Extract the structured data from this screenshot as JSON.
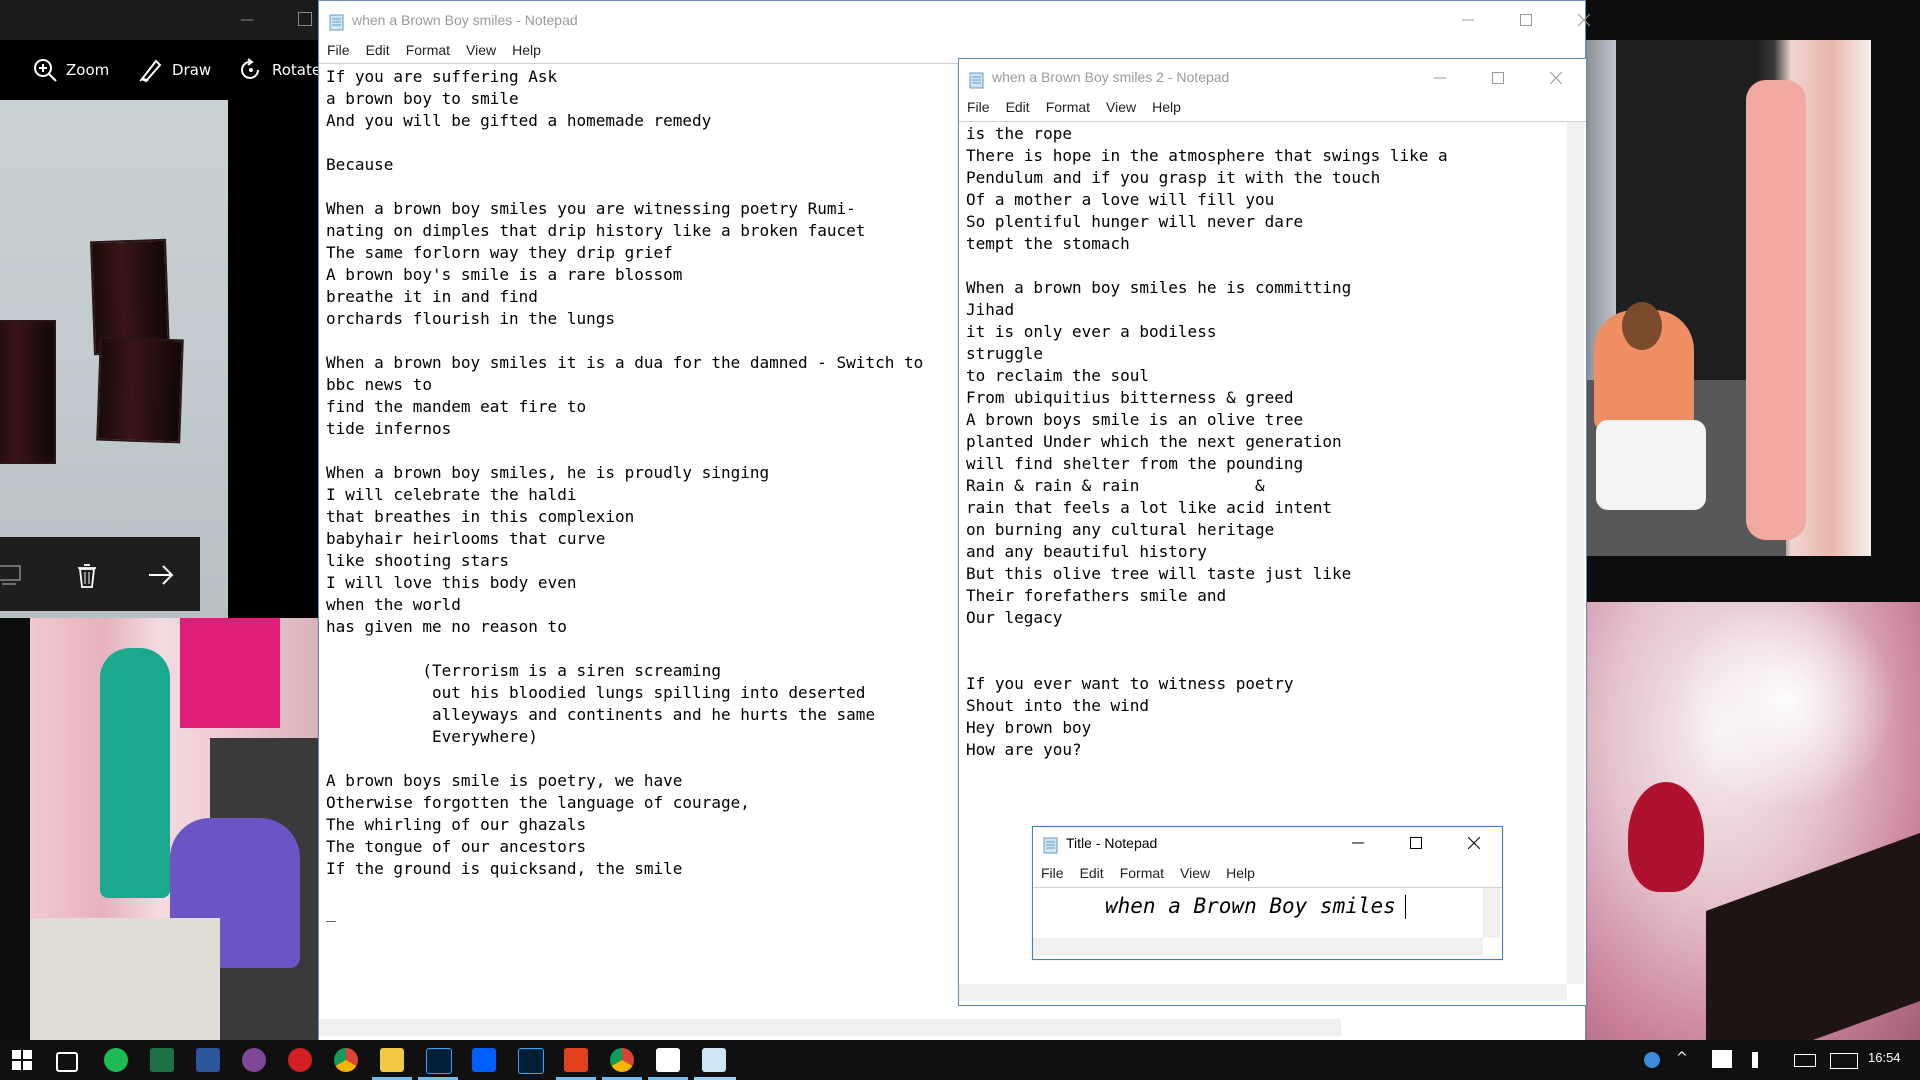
{
  "photos_app": {
    "toolbar": {
      "zoom": "Zoom",
      "draw": "Draw",
      "rotate": "Rotate"
    }
  },
  "notepad1": {
    "title": "when a Brown Boy smiles - Notepad",
    "menu": [
      "File",
      "Edit",
      "Format",
      "View",
      "Help"
    ],
    "text": "If you are suffering Ask\na brown boy to smile\nAnd you will be gifted a homemade remedy\n\nBecause\n\nWhen a brown boy smiles you are witnessing poetry Rumi-\nnating on dimples that drip history like a broken faucet\nThe same forlorn way they drip grief\nA brown boy's smile is a rare blossom\nbreathe it in and find\norchards flourish in the lungs\n\nWhen a brown boy smiles it is a dua for the damned - Switch to\nbbc news to\nfind the mandem eat fire to\ntide infernos\n\nWhen a brown boy smiles, he is proudly singing\nI will celebrate the haldi\nthat breathes in this complexion\nbabyhair heirlooms that curve\nlike shooting stars\nI will love this body even\nwhen the world\nhas given me no reason to\n\n          (Terrorism is a siren screaming\n           out his bloodied lungs spilling into deserted\n           alleyways and continents and he hurts the same\n           Everywhere)\n\nA brown boys smile is poetry, we have\nOtherwise forgotten the language of courage,\nThe whirling of our ghazals\nThe tongue of our ancestors\nIf the ground is quicksand, the smile\n\n_"
  },
  "notepad2": {
    "title": "when a Brown Boy smiles 2 - Notepad",
    "menu": [
      "File",
      "Edit",
      "Format",
      "View",
      "Help"
    ],
    "text": "is the rope\nThere is hope in the atmosphere that swings like a\nPendulum and if you grasp it with the touch\nOf a mother a love will fill you\nSo plentiful hunger will never dare\ntempt the stomach\n\nWhen a brown boy smiles he is committing\nJihad\nit is only ever a bodiless\nstruggle\nto reclaim the soul\nFrom ubiquitius bitterness & greed\nA brown boys smile is an olive tree\nplanted Under which the next generation\nwill find shelter from the pounding\nRain & rain & rain            &\nrain that feels a lot like acid intent\non burning any cultural heritage\nand any beautiful history\nBut this olive tree will taste just like\nTheir forefathers smile and\nOur legacy\n\n\nIf you ever want to witness poetry\nShout into the wind\nHey brown boy\nHow are you?"
  },
  "notepad3": {
    "title": "Title - Notepad",
    "menu": [
      "File",
      "Edit",
      "Format",
      "View",
      "Help"
    ],
    "text": "when a Brown Boy smiles"
  },
  "taskbar": {
    "time": "16:54",
    "pinned": [
      "start-icon",
      "task-view-icon",
      "spotify-icon",
      "excel-icon",
      "word-icon",
      "tor-icon",
      "ipvanish-icon",
      "chrome-icon",
      "file-explorer-icon",
      "photoshop-icon",
      "dropbox-icon",
      "lightroom-icon",
      "acrobat-icon",
      "chrome-icon-2",
      "photos-icon",
      "notepad-icon"
    ]
  },
  "colors": {
    "accent": "#76b9ed",
    "taskbar": "#101010"
  }
}
